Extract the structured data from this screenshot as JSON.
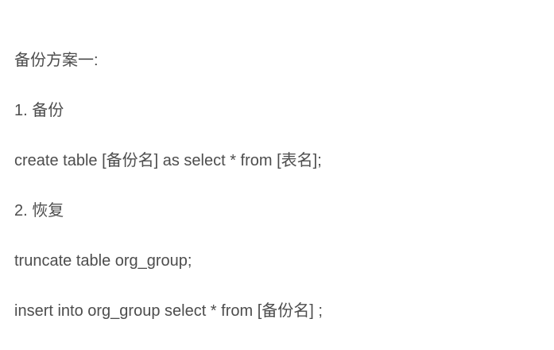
{
  "lines": [
    "备份方案一:",
    "1. 备份",
    "create table [备份名] as select * from [表名];",
    "2. 恢复",
    "truncate table org_group;",
    "insert into org_group select * from [备份名] ;"
  ]
}
